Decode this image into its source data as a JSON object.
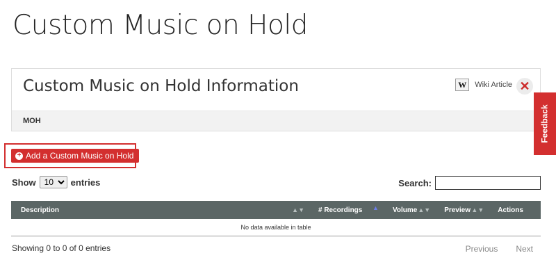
{
  "page": {
    "title": "Custom Music on Hold"
  },
  "info_panel": {
    "title": "Custom Music on Hold Information",
    "wiki_icon": "W",
    "wiki_label": "Wiki Article",
    "close_icon": "✕",
    "tab": "MOH"
  },
  "feedback": {
    "label": "Feedback"
  },
  "actions": {
    "add_button": "Add a Custom Music on Hold",
    "add_icon": "+"
  },
  "length": {
    "show_label": "Show",
    "value": "10",
    "options": [
      "10"
    ],
    "entries_label": "entries"
  },
  "search": {
    "label": "Search:",
    "value": "",
    "placeholder": ""
  },
  "table": {
    "headers": [
      "Description",
      "# Recordings",
      "Volume",
      "Preview",
      "Actions"
    ],
    "empty_message": "No data available in table"
  },
  "footer": {
    "info": "Showing 0 to 0 of 0 entries",
    "previous": "Previous",
    "next": "Next"
  },
  "colors": {
    "accent": "#d32f2f",
    "table_header": "#5b6665"
  }
}
